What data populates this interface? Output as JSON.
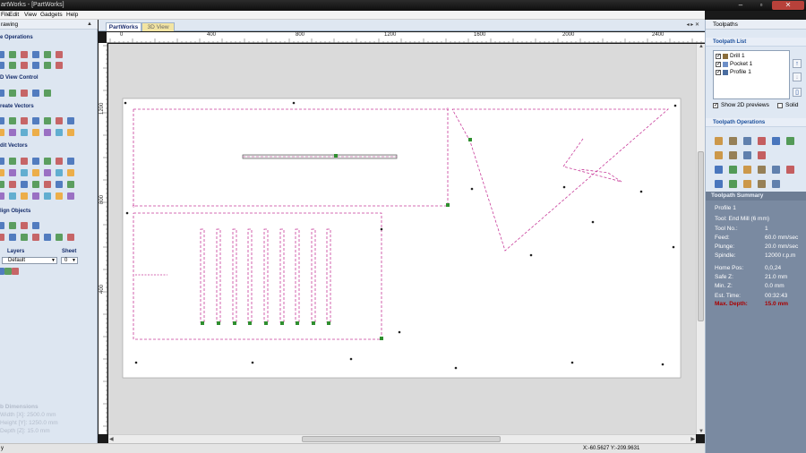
{
  "window": {
    "title": "artWorks - [PartWorks]"
  },
  "menu": {
    "items": [
      "File",
      "Edit",
      "View",
      "Gadgets",
      "Help"
    ]
  },
  "left_panel": {
    "header": "rawing",
    "pin": "▲",
    "sections": {
      "file_ops": "e Operations",
      "view_control": "D View Control",
      "create_vectors": "reate Vectors",
      "edit_vectors": "dit Vectors",
      "align_objects": "lign Objects"
    },
    "layers": {
      "label": "Layers",
      "sheet_label": "Sheet",
      "layer_value": "Default",
      "sheet_value": "0"
    },
    "dimensions": {
      "title": "b Dimensions",
      "width": "Width  [X]: 2500.0 mm",
      "height": "Height [Y]: 1250.0 mm",
      "depth": "Depth  [Z]: 15.0 mm"
    }
  },
  "tabs": {
    "active": "PartWorks",
    "other": "3D View",
    "nav": "◂ ▸ ✕"
  },
  "rulers": {
    "h_labels": [
      "0",
      "400",
      "800",
      "1200",
      "1600",
      "2000",
      "2400"
    ],
    "v_labels": [
      "1200",
      "800",
      "400"
    ]
  },
  "status": {
    "left": "y",
    "coords": "X:-60.5627 Y:-209.9631"
  },
  "right_panel": {
    "title": "Toolpaths",
    "list_section": "Toolpath List",
    "toolpaths": [
      {
        "name": "Drill 1",
        "checked": true
      },
      {
        "name": "Pocket 1",
        "checked": true
      },
      {
        "name": "Profile 1",
        "checked": true
      }
    ],
    "show_previews": "Show 2D previews",
    "solid": "Solid",
    "operations_section": "Toolpath Operations",
    "summary": {
      "title": "Toolpath Summary",
      "name": "Profile 1",
      "tool": "Tool: End Mill (6 mm)",
      "rows": [
        {
          "label": "Tool No.:",
          "value": "1"
        },
        {
          "label": "Feed:",
          "value": "60.0 mm/sec"
        },
        {
          "label": "Plunge:",
          "value": "20.0 mm/sec"
        },
        {
          "label": "Spindle:",
          "value": "12000 r.p.m"
        },
        {
          "label": "Home Pos:",
          "value": "0,0,24"
        },
        {
          "label": "Safe Z:",
          "value": "21.0 mm"
        },
        {
          "label": "Min. Z:",
          "value": "0.0 mm"
        },
        {
          "label": "Est. Time:",
          "value": "00:32:43"
        }
      ],
      "max_depth_label": "Max. Depth:",
      "max_depth_value": "15.0 mm"
    }
  },
  "colors": {
    "toolpath": "#c83c9a",
    "rapid": "#3a3a3a",
    "start_marker": "#2f8f2f",
    "accent": "#1b4f9c",
    "warning": "#a90000"
  }
}
